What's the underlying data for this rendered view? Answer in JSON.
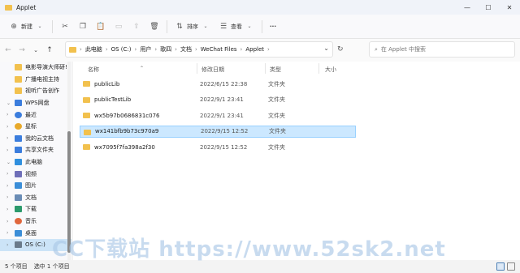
{
  "window": {
    "title": "Applet",
    "minimize": "—",
    "maximize": "☐",
    "close": "✕"
  },
  "toolbar": {
    "new_label": "新建",
    "sort_label": "排序",
    "view_label": "查看",
    "more_label": "···"
  },
  "nav": {
    "back": "←",
    "forward": "→",
    "down": "⌄",
    "up": "↑"
  },
  "breadcrumb": [
    "此电脑",
    "OS (C:)",
    "用户",
    "歌四",
    "文档",
    "WeChat Files",
    "Applet"
  ],
  "search": {
    "placeholder": "在 Applet 中搜索"
  },
  "sidebar": {
    "items": [
      {
        "label": "电影导演大师研!",
        "icon": "folder-icon",
        "color": "#f2c14e",
        "chev": ""
      },
      {
        "label": "广播电视主持",
        "icon": "folder-icon",
        "color": "#f2c14e",
        "chev": ""
      },
      {
        "label": "视听广告创作",
        "icon": "folder-icon",
        "color": "#f2c14e",
        "chev": ""
      },
      {
        "label": "WPS网盘",
        "icon": "cloud-icon",
        "color": "#3b7ddd",
        "chev": "⌄"
      },
      {
        "label": "最近",
        "icon": "clock-icon",
        "color": "#3b7ddd",
        "chev": "›"
      },
      {
        "label": "星标",
        "icon": "star-icon",
        "color": "#e8a92a",
        "chev": "›"
      },
      {
        "label": "我的云文档",
        "icon": "cloud-doc-icon",
        "color": "#3b7ddd",
        "chev": "›"
      },
      {
        "label": "共享文件夹",
        "icon": "shared-folder-icon",
        "color": "#3b7ddd",
        "chev": "›"
      },
      {
        "label": "此电脑",
        "icon": "pc-icon",
        "color": "#2f8fde",
        "chev": "⌄"
      },
      {
        "label": "视频",
        "icon": "video-icon",
        "color": "#6f6fb8",
        "chev": "›"
      },
      {
        "label": "图片",
        "icon": "pictures-icon",
        "color": "#3b8ed8",
        "chev": "›"
      },
      {
        "label": "文档",
        "icon": "documents-icon",
        "color": "#6a8cb5",
        "chev": "›"
      },
      {
        "label": "下载",
        "icon": "download-icon",
        "color": "#2c9a6c",
        "chev": "›"
      },
      {
        "label": "音乐",
        "icon": "music-icon",
        "color": "#e0663c",
        "chev": "›"
      },
      {
        "label": "桌面",
        "icon": "desktop-icon",
        "color": "#3b8ed8",
        "chev": "›"
      },
      {
        "label": "OS (C:)",
        "icon": "drive-icon",
        "color": "#6a7a8a",
        "chev": "›"
      }
    ]
  },
  "columns": {
    "name": "名称",
    "date": "修改日期",
    "type": "类型",
    "size": "大小"
  },
  "files": [
    {
      "name": "publicLib",
      "date": "2022/6/15 22:38",
      "type": "文件夹"
    },
    {
      "name": "publicTestLib",
      "date": "2022/9/1 23:41",
      "type": "文件夹"
    },
    {
      "name": "wx5b97b0686831c076",
      "date": "2022/9/1 23:41",
      "type": "文件夹"
    },
    {
      "name": "wx141bfb9b73c970a9",
      "date": "2022/9/15 12:52",
      "type": "文件夹"
    },
    {
      "name": "wx7095f7fa398a2f30",
      "date": "2022/9/15 12:52",
      "type": "文件夹"
    }
  ],
  "status": {
    "count": "5 个项目",
    "selected": "选中 1 个项目"
  },
  "watermark": "CC下载站  https://www.52sk2.net"
}
